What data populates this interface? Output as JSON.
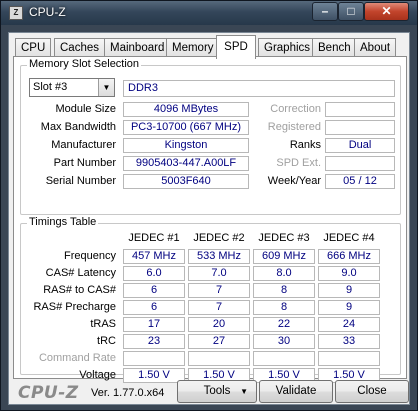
{
  "window": {
    "title": "CPU-Z",
    "icon_label": "Z"
  },
  "tabs": [
    {
      "label": "CPU"
    },
    {
      "label": "Caches"
    },
    {
      "label": "Mainboard"
    },
    {
      "label": "Memory"
    },
    {
      "label": "SPD"
    },
    {
      "label": "Graphics"
    },
    {
      "label": "Bench"
    },
    {
      "label": "About"
    }
  ],
  "active_tab": "SPD",
  "slot": {
    "group_title": "Memory Slot Selection",
    "selected": "Slot #3",
    "memory_type": "DDR3",
    "fields": {
      "module_size": {
        "label": "Module Size",
        "value": "4096 MBytes"
      },
      "max_bandwidth": {
        "label": "Max Bandwidth",
        "value": "PC3-10700 (667 MHz)"
      },
      "manufacturer": {
        "label": "Manufacturer",
        "value": "Kingston"
      },
      "part_number": {
        "label": "Part Number",
        "value": "9905403-447.A00LF"
      },
      "serial_number": {
        "label": "Serial Number",
        "value": "5003F640"
      }
    },
    "right_fields": {
      "correction": {
        "label": "Correction",
        "value": ""
      },
      "registered": {
        "label": "Registered",
        "value": ""
      },
      "ranks": {
        "label": "Ranks",
        "value": "Dual"
      },
      "spd_ext": {
        "label": "SPD Ext.",
        "value": ""
      },
      "week_year": {
        "label": "Week/Year",
        "value": "05 / 12"
      }
    }
  },
  "timings": {
    "group_title": "Timings Table",
    "columns": [
      "JEDEC #1",
      "JEDEC #2",
      "JEDEC #3",
      "JEDEC #4"
    ],
    "rows": [
      {
        "label": "Frequency",
        "values": [
          "457 MHz",
          "533 MHz",
          "609 MHz",
          "666 MHz"
        ]
      },
      {
        "label": "CAS# Latency",
        "values": [
          "6.0",
          "7.0",
          "8.0",
          "9.0"
        ]
      },
      {
        "label": "RAS# to CAS#",
        "values": [
          "6",
          "7",
          "8",
          "9"
        ]
      },
      {
        "label": "RAS# Precharge",
        "values": [
          "6",
          "7",
          "8",
          "9"
        ]
      },
      {
        "label": "tRAS",
        "values": [
          "17",
          "20",
          "22",
          "24"
        ]
      },
      {
        "label": "tRC",
        "values": [
          "23",
          "27",
          "30",
          "33"
        ]
      },
      {
        "label": "Command Rate",
        "values": [
          "",
          "",
          "",
          ""
        ],
        "disabled": true
      },
      {
        "label": "Voltage",
        "values": [
          "1.50 V",
          "1.50 V",
          "1.50 V",
          "1.50 V"
        ]
      }
    ]
  },
  "footer": {
    "brand": "CPU-Z",
    "version": "Ver. 1.77.0.x64",
    "tools_label": "Tools",
    "validate_label": "Validate",
    "close_label": "Close"
  }
}
